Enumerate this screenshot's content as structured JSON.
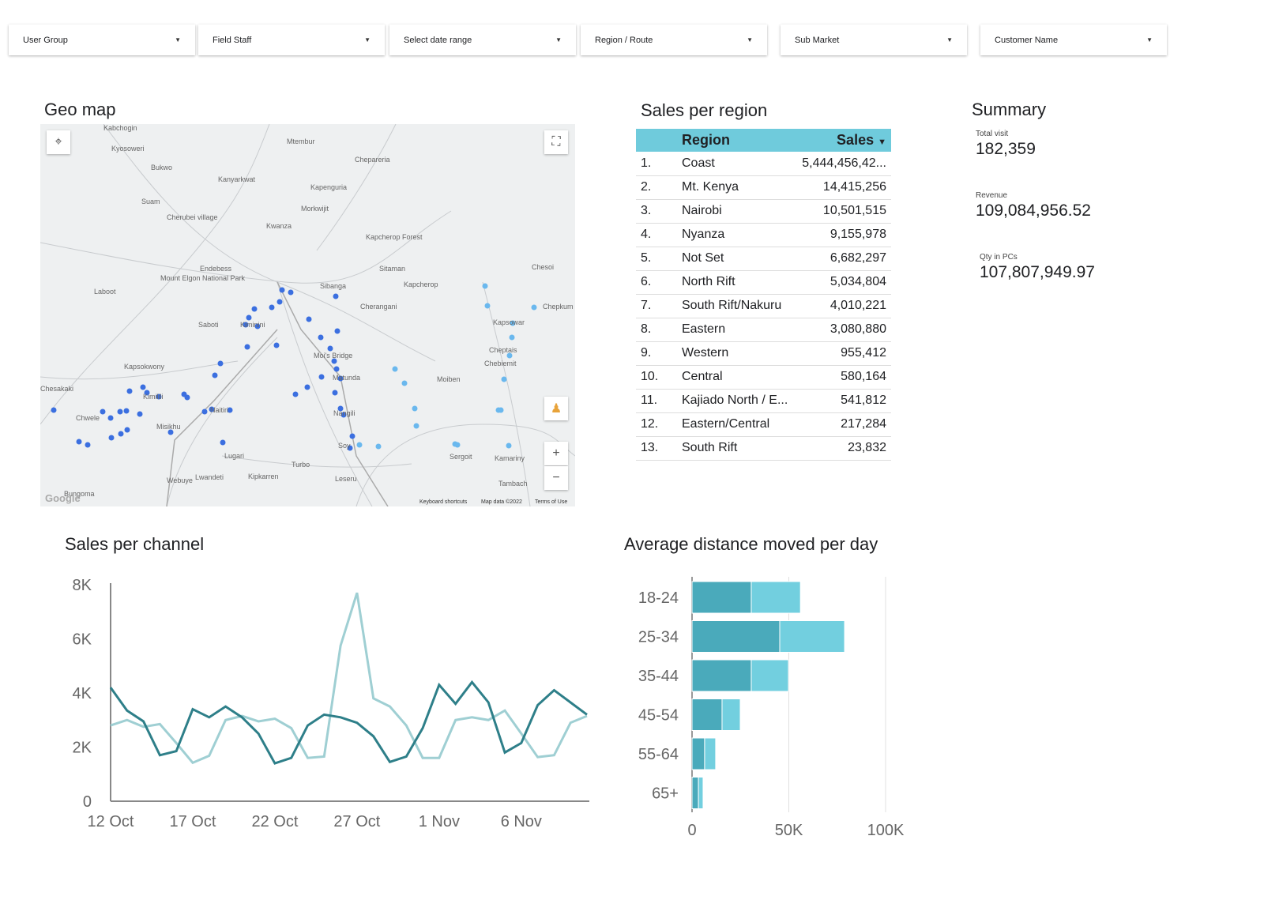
{
  "filters": [
    "User Group",
    "Field Staff",
    "Select date range",
    "Region / Route",
    "Sub Market",
    "Customer Name"
  ],
  "geo_map": {
    "title": "Geo map",
    "places": [
      "Kabchogin",
      "Kyosoweri",
      "Bukwo",
      "Mtembur",
      "Chepareria",
      "Kanyarkwat",
      "Kapenguria",
      "Suam",
      "Cherubei village",
      "Morkwijit",
      "Kwanza",
      "Kapcherop Forest",
      "Endebess",
      "Mount Elgon National Park",
      "Laboot",
      "Sibanga",
      "Sitaman",
      "Kapcherop",
      "Chesoi",
      "Cherangani",
      "Chepkum",
      "Saboti",
      "Kiminini",
      "Kapsowar",
      "Kapsokwony",
      "Moi's Bridge",
      "Chebiemit",
      "Cheptais",
      "Matunda",
      "Moiben",
      "Kimilili",
      "Chesakaki",
      "Chwele",
      "Misikhu",
      "Naitiri",
      "Lugari",
      "Turbo",
      "Sergoit",
      "Kamariny",
      "Webuye",
      "Lwandeti",
      "Kipkarren",
      "Leseru",
      "Tambach",
      "Bungoma",
      "Soy",
      "Nangili"
    ],
    "footer": [
      "Keyboard shortcuts",
      "Map data ©2022",
      "Terms of Use"
    ],
    "logo": "Google"
  },
  "sales_region": {
    "title": "Sales per region",
    "headers": [
      "Region",
      "Sales"
    ],
    "rows": [
      [
        "1.",
        "Coast",
        "5,444,456,42..."
      ],
      [
        "2.",
        "Mt. Kenya",
        "14,415,256"
      ],
      [
        "3.",
        "Nairobi",
        "10,501,515"
      ],
      [
        "4.",
        "Nyanza",
        "9,155,978"
      ],
      [
        "5.",
        "Not Set",
        "6,682,297"
      ],
      [
        "6.",
        "North Rift",
        "5,034,804"
      ],
      [
        "7.",
        "South Rift/Nakuru",
        "4,010,221"
      ],
      [
        "8.",
        "Eastern",
        "3,080,880"
      ],
      [
        "9.",
        "Western",
        "955,412"
      ],
      [
        "10.",
        "Central",
        "580,164"
      ],
      [
        "11.",
        "Kajiado North / E...",
        "541,812"
      ],
      [
        "12.",
        "Eastern/Central",
        "217,284"
      ],
      [
        "13.",
        "South Rift",
        "23,832"
      ]
    ]
  },
  "summary": {
    "title": "Summary",
    "items": [
      {
        "label": "Total visit",
        "value": "182,359"
      },
      {
        "label": "Revenue",
        "value": "109,084,956.52"
      },
      {
        "label": "Qty in PCs",
        "value": "107,807,949.97"
      }
    ]
  },
  "chart_data": [
    {
      "type": "line",
      "title": "Sales per channel",
      "ylim": [
        0,
        8000
      ],
      "yticks": [
        "0",
        "2K",
        "4K",
        "6K",
        "8K"
      ],
      "xticks": [
        "12 Oct",
        "17 Oct",
        "22 Oct",
        "27 Oct",
        "1 Nov",
        "6 Nov"
      ],
      "x": [
        "12 Oct",
        "13 Oct",
        "14 Oct",
        "15 Oct",
        "16 Oct",
        "17 Oct",
        "18 Oct",
        "19 Oct",
        "20 Oct",
        "21 Oct",
        "22 Oct",
        "23 Oct",
        "24 Oct",
        "25 Oct",
        "26 Oct",
        "27 Oct",
        "28 Oct",
        "29 Oct",
        "30 Oct",
        "31 Oct",
        "1 Nov",
        "2 Nov",
        "3 Nov",
        "4 Nov",
        "5 Nov",
        "6 Nov",
        "7 Nov",
        "8 Nov",
        "9 Nov",
        "10 Nov"
      ],
      "series": [
        {
          "name": "series 1",
          "color": "#2e7f89",
          "values": [
            4200,
            3350,
            2950,
            1700,
            1850,
            3400,
            3100,
            3500,
            3100,
            2500,
            1400,
            1600,
            2800,
            3200,
            3100,
            2900,
            2400,
            1450,
            1650,
            2700,
            4300,
            3600,
            4400,
            3650,
            1800,
            2150,
            3550,
            4100,
            3650,
            3200
          ]
        },
        {
          "name": "series 2",
          "color": "#9fcfd3",
          "values": [
            2800,
            3000,
            2750,
            2850,
            2150,
            1420,
            1680,
            3000,
            3150,
            2950,
            3050,
            2700,
            1600,
            1650,
            5750,
            7700,
            3800,
            3500,
            2800,
            1600,
            1600,
            3000,
            3100,
            3000,
            3350,
            2500,
            1630,
            1700,
            2900,
            3150
          ]
        }
      ]
    },
    {
      "type": "bar",
      "orientation": "horizontal",
      "stacked": true,
      "title": "Average distance moved per day",
      "categories": [
        "18-24",
        "25-34",
        "35-44",
        "45-54",
        "55-64",
        "65+"
      ],
      "xlim": [
        0,
        100000
      ],
      "xticks": [
        "0",
        "50K",
        "100K"
      ],
      "series": [
        {
          "name": "series 1",
          "color": "#4aaabb",
          "values": [
            30600,
            45300,
            30600,
            15500,
            6500,
            3300
          ]
        },
        {
          "name": "series 2",
          "color": "#72cfdf",
          "values": [
            25400,
            33500,
            19200,
            9400,
            5700,
            2400
          ]
        }
      ]
    }
  ]
}
